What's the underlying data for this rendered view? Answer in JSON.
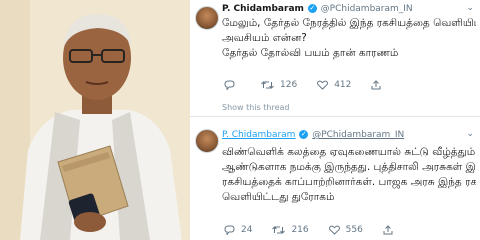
{
  "tweets": [
    {
      "name": "P. Chidambaram",
      "handle": "@PChidambaram_IN",
      "lines": [
        "மேலும், தேர்தல் நேரத்தில் இந்த ரகசியத்தை வெளியிட வேண்டிய",
        "அவசியம் என்ன?",
        "தேர்தல் தோல்வி பயம் தான் காரணம்"
      ],
      "replies": "",
      "retweets": "126",
      "likes": "412",
      "show_thread": "Show this thread"
    },
    {
      "name": "P. Chidambaram",
      "handle": "@PChidambaram_IN",
      "lines": [
        "விண்வெளிக் கலத்தை ஏவுகணையால் சுட்டு வீழ்த்தும் ஆற்றல் பல",
        "ஆண்டுகளாக நமக்கு இருந்தது. புத்திசாலி அரசுகள் இந்த",
        "ரகசியத்தைக் காப்பாற்றினார்கள். பாஜக அரசு இந்த ரகசியத்தை",
        "வெளியிட்டது துரோகம்"
      ],
      "replies": "24",
      "retweets": "216",
      "likes": "556"
    }
  ],
  "colors": {
    "accent": "#1da1f2",
    "muted": "#657786",
    "text": "#14171a"
  }
}
